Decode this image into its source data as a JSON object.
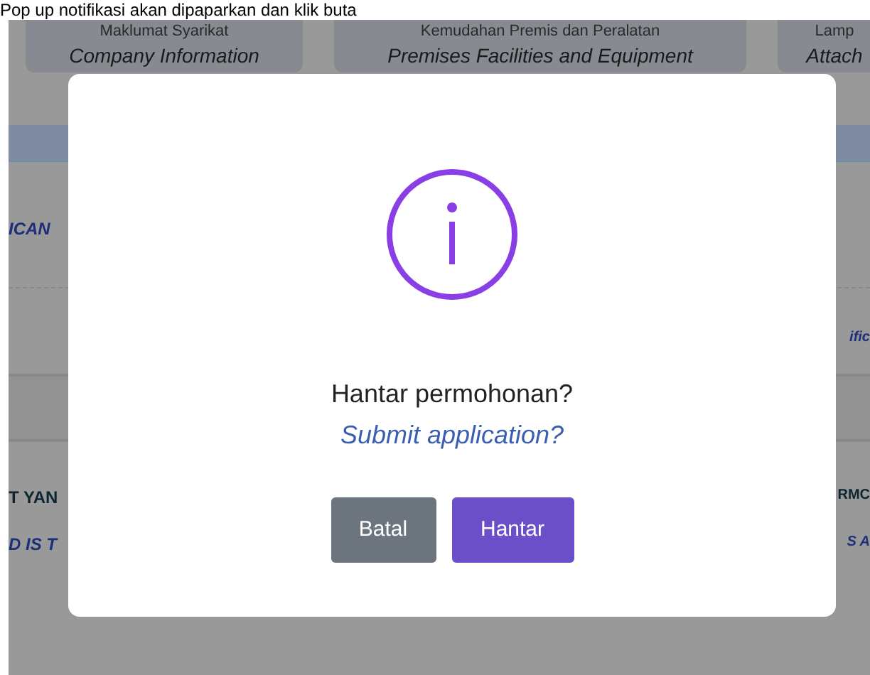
{
  "caption": "Pop up notifikasi akan dipaparkan dan klik buta",
  "cards": [
    {
      "title": "Maklumat Syarikat",
      "subtitle": "Company Information"
    },
    {
      "title": "Kemudahan Premis dan Peralatan",
      "subtitle": "Premises Facilities and Equipment"
    },
    {
      "title": "Lamp",
      "subtitle": "Attach"
    }
  ],
  "background_fragments": {
    "left": [
      "ICAN",
      "T YAN",
      "D IS T"
    ],
    "right": [
      "ific",
      "RMC",
      "S A"
    ]
  },
  "dialog": {
    "message": "Hantar permohonan?",
    "message_en": "Submit application?",
    "buttons": [
      {
        "label": "Batal",
        "kind": "cancel"
      },
      {
        "label": "Hantar",
        "kind": "confirm"
      }
    ]
  }
}
